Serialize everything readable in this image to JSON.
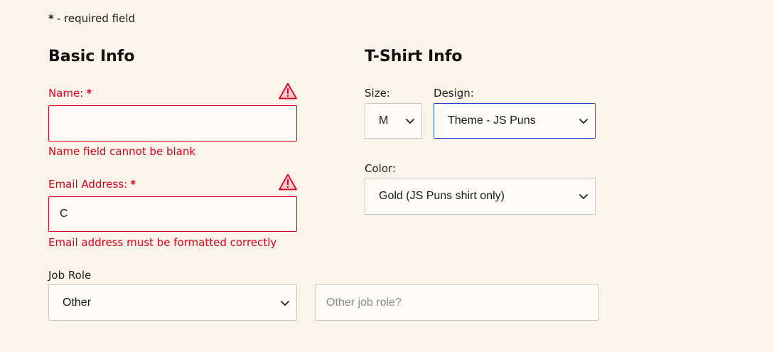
{
  "required_note": {
    "star": "*",
    "text": "- required field"
  },
  "basic_info": {
    "title": "Basic Info",
    "name": {
      "label": "Name:",
      "required_marker": "*",
      "value": "",
      "error": "Name field cannot be blank",
      "icon": "warning-triangle-icon"
    },
    "email": {
      "label": "Email Address:",
      "required_marker": "*",
      "value": "C",
      "error": "Email address must be formatted correctly",
      "icon": "warning-triangle-icon"
    },
    "job_role": {
      "label": "Job Role",
      "selected": "Other",
      "other_placeholder": "Other job role?"
    }
  },
  "tshirt_info": {
    "title": "T-Shirt Info",
    "size": {
      "label": "Size:",
      "selected": "M"
    },
    "design": {
      "label": "Design:",
      "selected": "Theme - JS Puns"
    },
    "color": {
      "label": "Color:",
      "selected": "Gold (JS Puns shirt only)"
    }
  },
  "colors": {
    "background": "#fbf4ea",
    "error": "#e0001b",
    "focus_border": "#1f4fbf",
    "field_border": "#c9c9c9"
  }
}
